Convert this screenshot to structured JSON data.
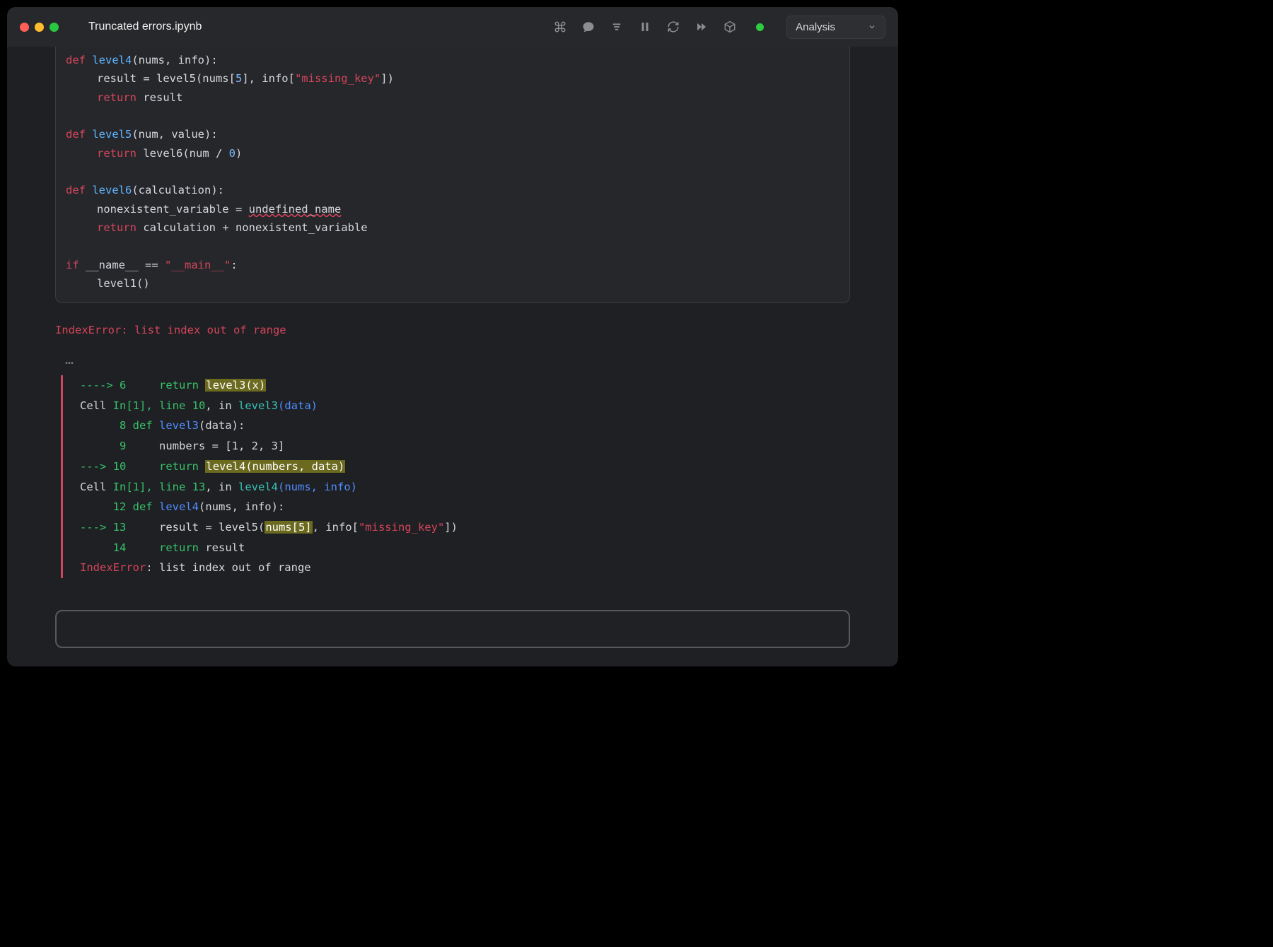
{
  "titlebar": {
    "title": "Truncated errors.ipynb",
    "env_label": "Analysis"
  },
  "code": {
    "l1_def": "def",
    "l1_fn": "level4",
    "l1_sig": "(nums, info):",
    "l2_a": "result = level5(nums[",
    "l2_idx": "5",
    "l2_b": "], info[",
    "l2_key": "\"missing_key\"",
    "l2_c": "])",
    "l3_ret": "return",
    "l3_val": " result",
    "l4_def": "def",
    "l4_fn": "level5",
    "l4_sig": "(num, value):",
    "l5_ret": "return",
    "l5_a": " level6(num / ",
    "l5_zero": "0",
    "l5_b": ")",
    "l6_def": "def",
    "l6_fn": "level6",
    "l6_sig": "(calculation):",
    "l7_a": "nonexistent_variable = ",
    "l7_err": "undefined_name",
    "l8_ret": "return",
    "l8_val": " calculation + nonexistent_variable",
    "l9_if": "if",
    "l9_a": " __name__ == ",
    "l9_str": "\"__main__\"",
    "l9_b": ":",
    "l10": "level1()"
  },
  "error": {
    "title": "IndexError: list index out of range",
    "ellipsis": "…",
    "t1_arrow": "----> ",
    "t1_num": "6",
    "t1_pad": "    ",
    "t1_ret": "return",
    "t1_hl": "level3(x)",
    "t2_a": "Cell ",
    "t2_in": "In[1], line 10",
    "t2_b": ", in ",
    "t2_fn": "level3",
    "t2_paren_o": "(",
    "t2_arg": "data",
    "t2_paren_c": ")",
    "t3_num": "      8",
    "t3_def": " def",
    "t3_fn": " level3",
    "t3_sig": "(data):",
    "t4_num": "      9",
    "t4_body": "     numbers = [1, 2, 3]",
    "t5_arrow": "---> ",
    "t5_num": "10",
    "t5_pad": "    ",
    "t5_ret": "return",
    "t5_hl": "level4(numbers, data)",
    "t6_a": "Cell ",
    "t6_in": "In[1], line 13",
    "t6_b": ", in ",
    "t6_fn": "level4",
    "t6_paren_o": "(",
    "t6_arg1": "nums",
    "t6_comma": ", ",
    "t6_arg2": "info",
    "t6_paren_c": ")",
    "t7_num": "     12",
    "t7_def": " def",
    "t7_fn": " level4",
    "t7_sig": "(nums, info):",
    "t8_arrow": "---> ",
    "t8_num": "13",
    "t8_a": "     result = level5(",
    "t8_hl": "nums[5]",
    "t8_b": ", info[",
    "t8_key": "\"missing_key\"",
    "t8_c": "])",
    "t9_num": "     14",
    "t9_ret": "    return",
    "t9_val": " result",
    "t10_err": "IndexError",
    "t10_msg": ": list index out of range"
  }
}
